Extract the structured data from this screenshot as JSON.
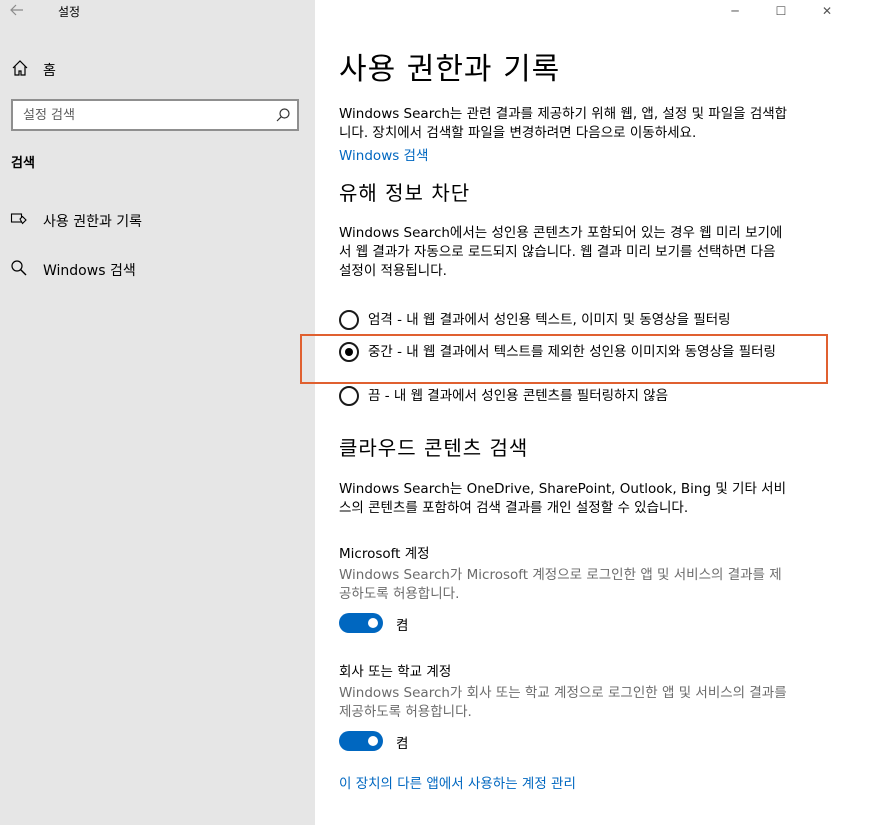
{
  "window": {
    "title": "설정"
  },
  "sidebar": {
    "home_label": "홈",
    "search_placeholder": "설정 검색",
    "section_header": "검색",
    "items": [
      {
        "label": "사용 권한과 기록",
        "icon": "permissions-icon"
      },
      {
        "label": "Windows 검색",
        "icon": "search-icon"
      }
    ]
  },
  "main": {
    "title": "사용 권한과 기록",
    "intro": "Windows Search는 관련 결과를 제공하기 위해 웹, 앱, 설정 및 파일을 검색합니다. 장치에서 검색할 파일을 변경하려면 다음으로 이동하세요.",
    "intro_link": "Windows 검색",
    "safesearch": {
      "heading": "유해 정보 차단",
      "description": "Windows Search에서는 성인용 콘텐츠가 포함되어 있는 경우 웹 미리 보기에서 웹 결과가 자동으로 로드되지 않습니다. 웹 결과 미리 보기를 선택하면 다음 설정이 적용됩니다.",
      "options": [
        {
          "label": "엄격 - 내 웹 결과에서 성인용 텍스트, 이미지 및 동영상을 필터링",
          "checked": false
        },
        {
          "label": "중간 - 내 웹 결과에서 텍스트를 제외한 성인용 이미지와 동영상을 필터링",
          "checked": true
        },
        {
          "label": "끔 - 내 웹 결과에서 성인용 콘텐츠를 필터링하지 않음",
          "checked": false
        }
      ]
    },
    "cloud": {
      "heading": "클라우드 콘텐츠 검색",
      "description": "Windows Search는 OneDrive, SharePoint, Outlook, Bing 및 기타 서비스의 콘텐츠를 포함하여 검색 결과를 개인 설정할 수 있습니다.",
      "microsoft_account": {
        "title": "Microsoft 계정",
        "description": "Windows Search가 Microsoft 계정으로 로그인한 앱 및 서비스의 결과를 제공하도록 허용합니다.",
        "toggle_label": "켬"
      },
      "work_account": {
        "title": "회사 또는 학교 계정",
        "description": "Windows Search가 회사 또는 학교 계정으로 로그인한 앱 및 서비스의 결과를 제공하도록 허용합니다.",
        "toggle_label": "켬"
      },
      "manage_link": "이 장치의 다른 앱에서 사용하는 계정 관리"
    }
  },
  "colors": {
    "accent": "#0067c0",
    "sidebar_bg": "#e6e6e6",
    "highlight": "#e06030"
  }
}
